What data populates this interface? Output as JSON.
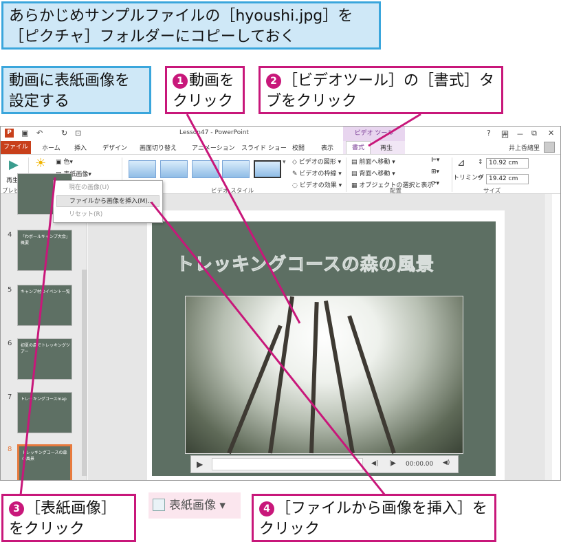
{
  "notes": {
    "intro": "あらかじめサンプルファイルの［hyoushi.jpg］を［ピクチャ］フォルダーにコピーしておく",
    "task": "動画に表紙画像を設定する",
    "step1_num": "❶",
    "step1": "動画をクリック",
    "step2_num": "❷",
    "step2": "［ビデオツール］の［書式］タブをクリック",
    "step3_num": "❸",
    "step3": "［表紙画像］をクリック",
    "step4_num": "❹",
    "step4": "［ファイルから画像を挿入］をクリック"
  },
  "window": {
    "title": "Lesson47 - PowerPoint",
    "context_tab": "ビデオ ツール",
    "user": "井上香緒里",
    "controls": [
      "?",
      "囲",
      "－",
      "⧉",
      "✕"
    ]
  },
  "tabs": [
    "ファイル",
    "ホーム",
    "挿入",
    "デザイン",
    "画面切り替え",
    "アニメーション",
    "スライド ショー",
    "校閲",
    "表示",
    "書式",
    "再生"
  ],
  "ribbon": {
    "play": "再生",
    "preview_group": "プレビュー",
    "adjust": "修整",
    "color": "色",
    "cover_image": "表紙画像",
    "video_shape": "ビデオの図形",
    "video_border": "ビデオの枠線",
    "video_effect": "ビデオの効果",
    "video_style_group": "ビデオ スタイル",
    "bring_forward": "前面へ移動",
    "send_backward": "背面へ移動",
    "selection_pane": "オブジェクトの選択と表示",
    "arrange_group": "配置",
    "crop": "トリミング",
    "height": "10.92 cm",
    "width": "19.42 cm",
    "size_group": "サイズ"
  },
  "dropdown": {
    "current_image": "現在の画像(U)",
    "insert_from_file": "ファイルから画像を挿入(M)...",
    "reset": "リセット(R)"
  },
  "slides": [
    {
      "num": "4",
      "title": "「わボールキャンプ大会」概要"
    },
    {
      "num": "5",
      "title": "キャンプ村のイベント一覧"
    },
    {
      "num": "6",
      "title": "初夏の森でトレッキングツアー"
    },
    {
      "num": "7",
      "title": "トレッキングコースmap"
    },
    {
      "num": "8",
      "title": "トレッキングコースの森の風景"
    }
  ],
  "slide_title": "トレッキングコースの森の風景",
  "video_time": "00:00.00",
  "cover_button_label": "表紙画像",
  "colors": {
    "accent": "#c8177a",
    "note_blue": "#3aa6dc",
    "file_tab": "#c8401b",
    "context": "#7a3d96"
  }
}
